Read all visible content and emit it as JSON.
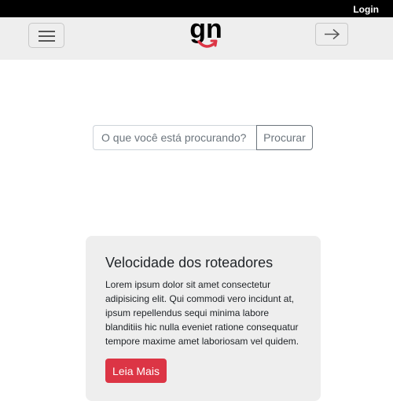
{
  "topbar": {
    "login_label": "Login"
  },
  "header": {
    "logo_text": "gn",
    "menu_icon": "hamburger-menu-icon",
    "arrow_icon": "arrow-right-icon"
  },
  "search": {
    "placeholder": "O que você está procurando?",
    "value": "",
    "button_label": "Procurar"
  },
  "card": {
    "title": "Velocidade dos roteadores",
    "text": "Lorem ipsum dolor sit amet consectetur adipisicing elit. Qui commodi vero incidunt at, ipsum repellendus sequi minima labore blanditiis hic nulla eveniet ratione consequatur tempore maxime amet laboriosam vel quidem.",
    "button_label": "Leia Mais"
  },
  "colors": {
    "topbar": "#000000",
    "header": "#eeeeee",
    "accent": "#dc3545",
    "card": "#eeeeee"
  }
}
